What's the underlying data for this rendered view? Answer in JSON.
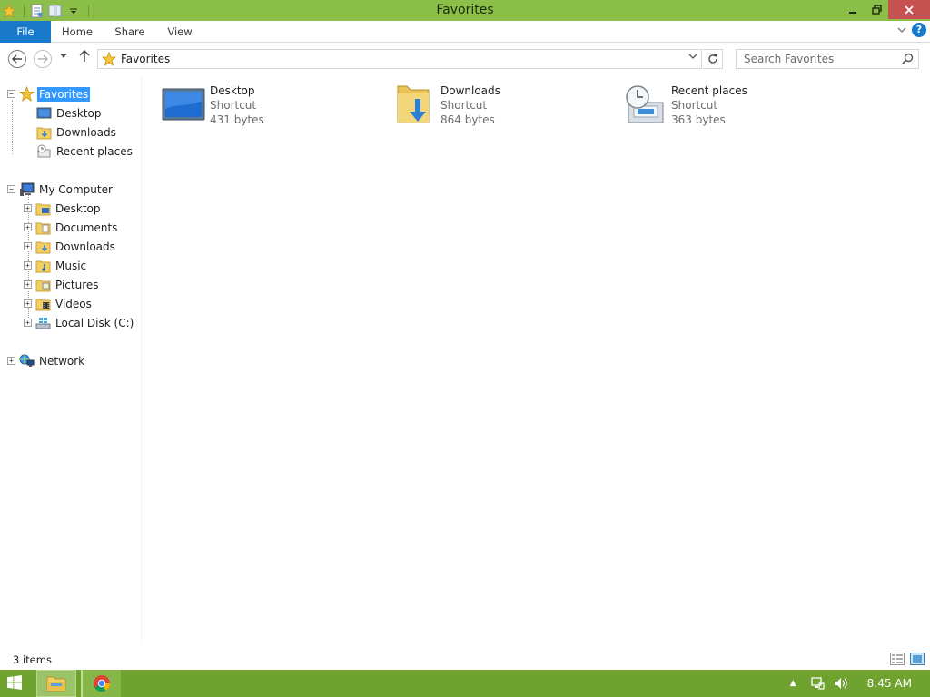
{
  "window": {
    "title": "Favorites",
    "minimize_label": "—",
    "restore_label": "❐",
    "close_label": "✕"
  },
  "ribbon": {
    "tabs": [
      "File",
      "Home",
      "Share",
      "View"
    ]
  },
  "address": {
    "path": "Favorites",
    "search_placeholder": "Search Favorites"
  },
  "nav": {
    "favorites": {
      "label": "Favorites",
      "children": [
        "Desktop",
        "Downloads",
        "Recent places"
      ]
    },
    "computer": {
      "label": "My Computer",
      "children": [
        "Desktop",
        "Documents",
        "Downloads",
        "Music",
        "Pictures",
        "Videos",
        "Local Disk (C:)"
      ]
    },
    "network": {
      "label": "Network"
    }
  },
  "items": [
    {
      "name": "Desktop",
      "type": "Shortcut",
      "size": "431 bytes",
      "icon": "desktop-icon"
    },
    {
      "name": "Downloads",
      "type": "Shortcut",
      "size": "864 bytes",
      "icon": "downloads-folder-icon"
    },
    {
      "name": "Recent places",
      "type": "Shortcut",
      "size": "363 bytes",
      "icon": "recent-places-icon"
    }
  ],
  "status": {
    "item_count": "3 items"
  },
  "taskbar": {
    "clock": "8:45 AM"
  },
  "colors": {
    "titlebar": "#8cbf4a",
    "file_tab": "#1979ca",
    "selection": "#3399ff",
    "taskbar": "#6fa22e",
    "close": "#c75050"
  }
}
